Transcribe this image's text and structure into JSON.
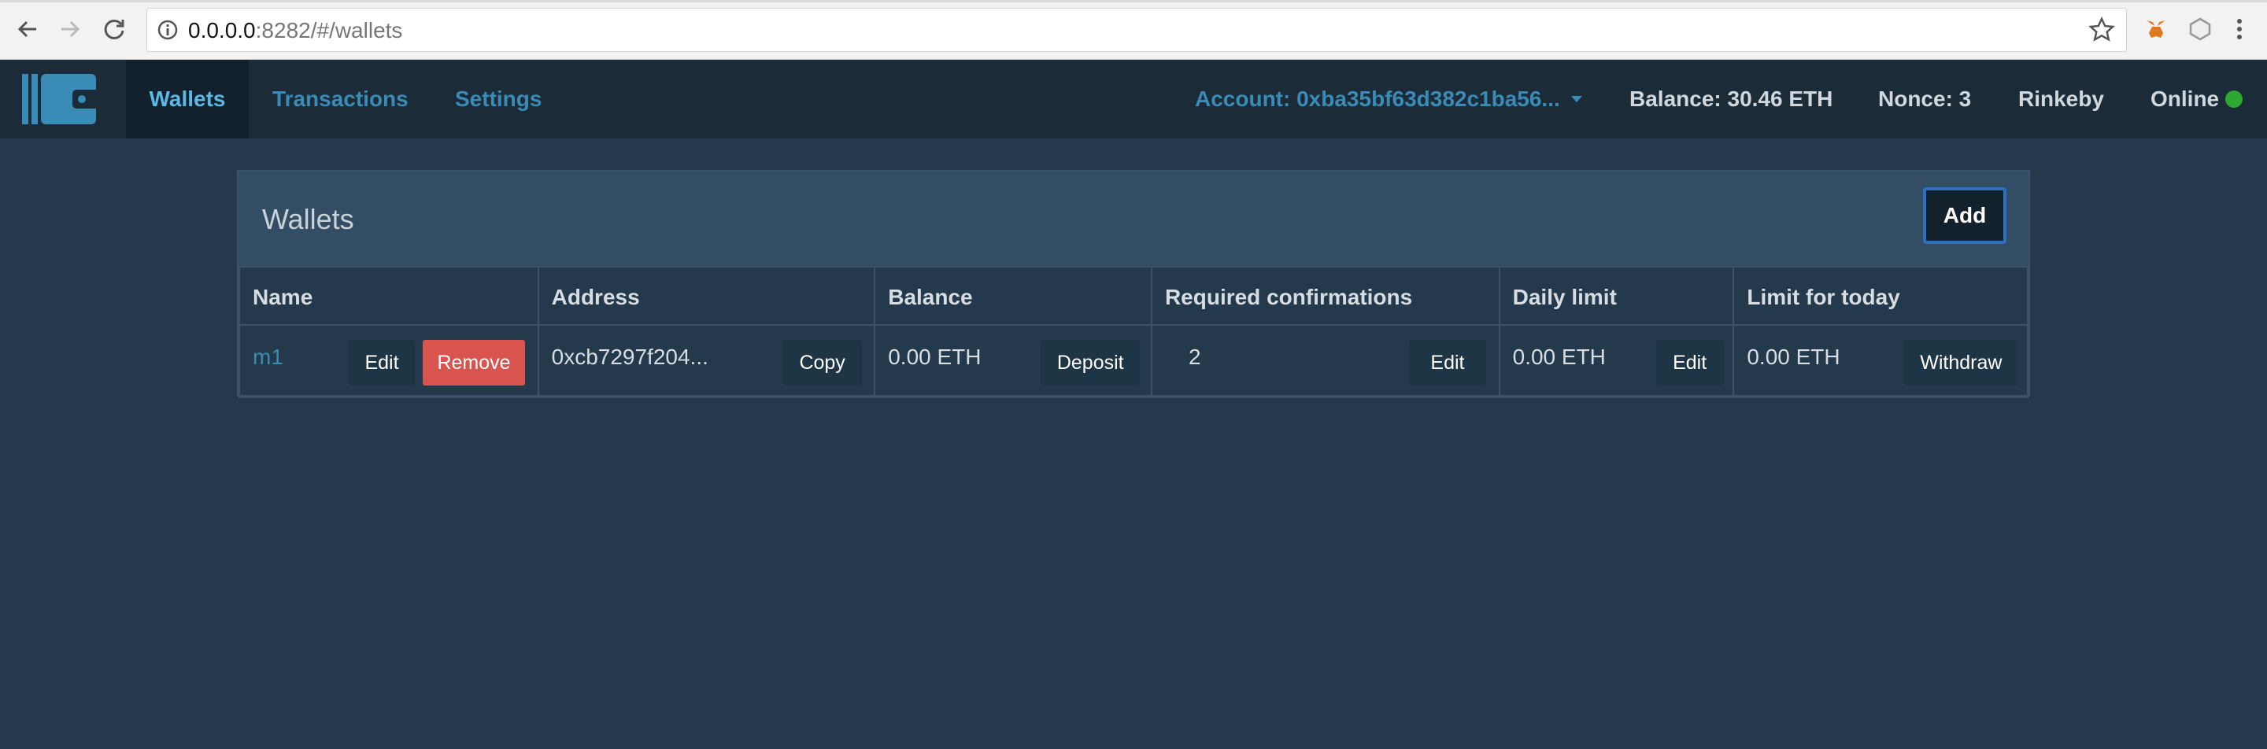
{
  "browser": {
    "url_host": "0.0.0.0",
    "url_rest": ":8282/#/wallets"
  },
  "navbar": {
    "tabs": [
      {
        "label": "Wallets",
        "active": true
      },
      {
        "label": "Transactions",
        "active": false
      },
      {
        "label": "Settings",
        "active": false
      }
    ],
    "account": "Account: 0xba35bf63d382c1ba56...",
    "balance": "Balance: 30.46 ETH",
    "nonce": "Nonce: 3",
    "network": "Rinkeby",
    "status": "Online",
    "status_color": "#2ea82e"
  },
  "panel": {
    "title": "Wallets",
    "add_label": "Add"
  },
  "table": {
    "headers": [
      "Name",
      "Address",
      "Balance",
      "Required confirmations",
      "Daily limit",
      "Limit for today"
    ],
    "rows": [
      {
        "name": "m1",
        "name_edit_label": "Edit",
        "remove_label": "Remove",
        "address": "0xcb7297f204...",
        "copy_label": "Copy",
        "balance": "0.00 ETH",
        "deposit_label": "Deposit",
        "required_confirmations": "2",
        "confirmations_edit_label": "Edit",
        "daily_limit": "0.00 ETH",
        "daily_limit_edit_label": "Edit",
        "limit_today": "0.00 ETH",
        "withdraw_label": "Withdraw"
      }
    ]
  },
  "colors": {
    "background": "#24394b",
    "navbar": "#1b2b38",
    "accent": "#3a8bb5",
    "danger": "#d9534f"
  }
}
